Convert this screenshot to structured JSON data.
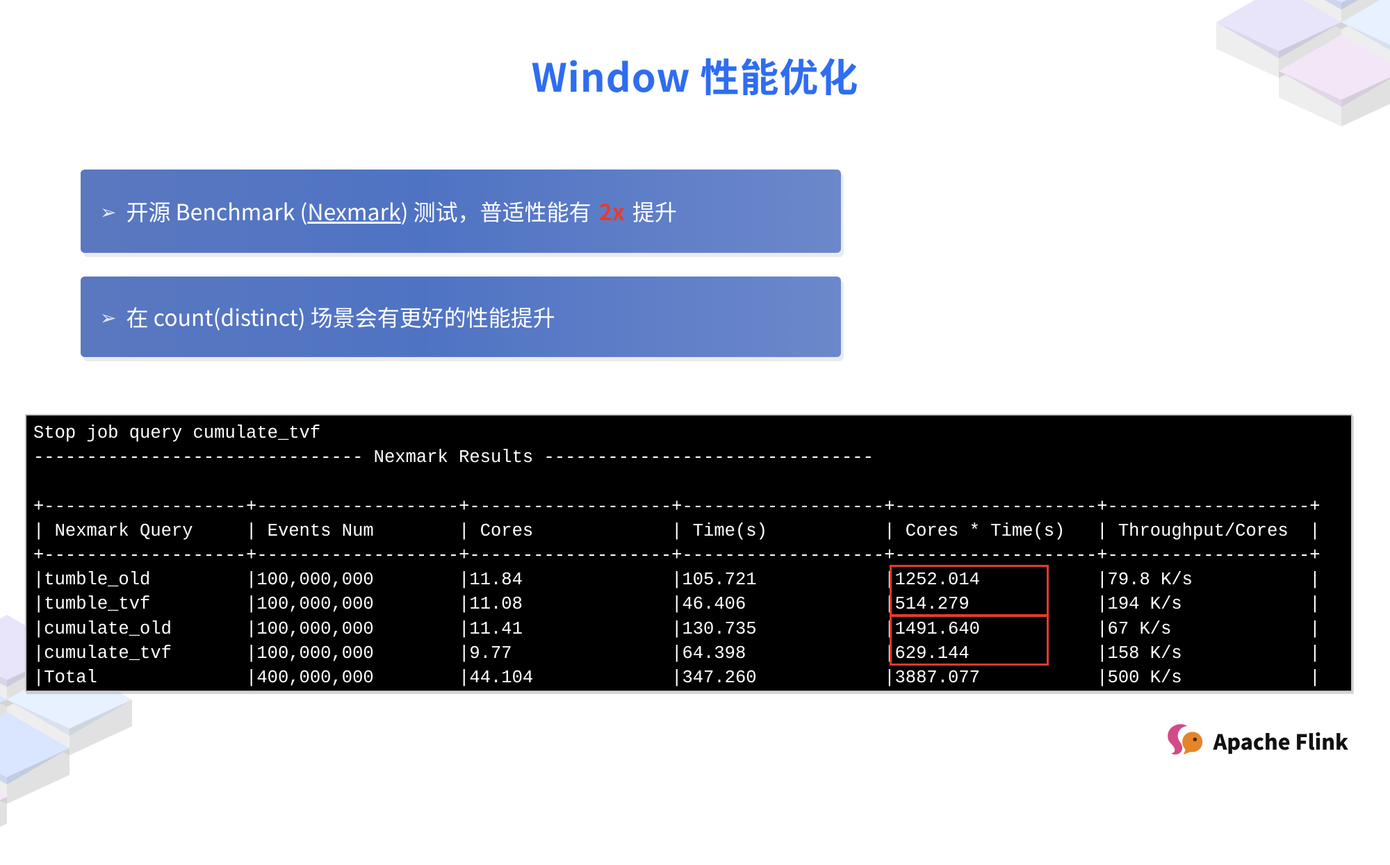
{
  "title": "Window 性能优化",
  "bullet1": {
    "pre": "开源 Benchmark (",
    "link": "Nexmark",
    "mid": ") 测试，普适性能有 ",
    "hl": "2x",
    "post": " 提升"
  },
  "bullet2": "在 count(distinct) 场景会有更好的性能提升",
  "arrow_glyph": "➢",
  "footer_brand": "Apache Flink",
  "terminal": {
    "header_job": "Stop job query cumulate_tvf",
    "header_sep": "------------------------------- Nexmark Results -------------------------------",
    "columns": [
      "Nexmark Query",
      "Events Num",
      "Cores",
      "Time(s)",
      "Cores * Time(s)",
      "Throughput/Cores"
    ],
    "rows": [
      {
        "q": "tumble_old",
        "ev": "100,000,000",
        "cores": "11.84",
        "time": "105.721",
        "ct": "1252.014",
        "tp": "79.8 K/s"
      },
      {
        "q": "tumble_tvf",
        "ev": "100,000,000",
        "cores": "11.08",
        "time": "46.406",
        "ct": "514.279",
        "tp": "194 K/s"
      },
      {
        "q": "cumulate_old",
        "ev": "100,000,000",
        "cores": "11.41",
        "time": "130.735",
        "ct": "1491.640",
        "tp": "67 K/s"
      },
      {
        "q": "cumulate_tvf",
        "ev": "100,000,000",
        "cores": "9.77",
        "time": "64.398",
        "ct": "629.144",
        "tp": "158 K/s"
      },
      {
        "q": "Total",
        "ev": "400,000,000",
        "cores": "44.104",
        "time": "347.260",
        "ct": "3887.077",
        "tp": "500 K/s"
      }
    ]
  },
  "chart_data": {
    "type": "table",
    "title": "Nexmark Results",
    "columns": [
      "Nexmark Query",
      "Events Num",
      "Cores",
      "Time(s)",
      "Cores * Time(s)",
      "Throughput/Cores"
    ],
    "categories": [
      "tumble_old",
      "tumble_tvf",
      "cumulate_old",
      "cumulate_tvf",
      "Total"
    ],
    "series": [
      {
        "name": "Events Num",
        "values": [
          100000000,
          100000000,
          100000000,
          100000000,
          400000000
        ]
      },
      {
        "name": "Cores",
        "values": [
          11.84,
          11.08,
          11.41,
          9.77,
          44.104
        ]
      },
      {
        "name": "Time(s)",
        "values": [
          105.721,
          46.406,
          130.735,
          64.398,
          347.26
        ]
      },
      {
        "name": "Cores * Time(s)",
        "values": [
          1252.014,
          514.279,
          1491.64,
          629.144,
          3887.077
        ]
      },
      {
        "name": "Throughput/Cores (K/s)",
        "values": [
          79.8,
          194,
          67,
          158,
          500
        ]
      }
    ],
    "highlight_column": "Cores * Time(s)",
    "highlight_groups": [
      [
        "tumble_old",
        "tumble_tvf"
      ],
      [
        "cumulate_old",
        "cumulate_tvf"
      ]
    ]
  }
}
